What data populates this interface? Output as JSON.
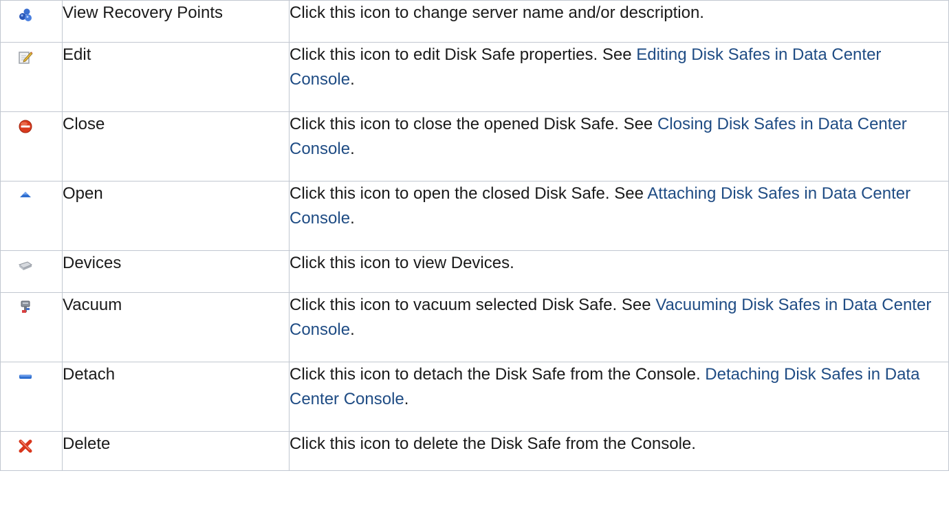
{
  "rows": [
    {
      "icon": "view-recovery-points-icon",
      "name": "View Recovery Points",
      "description": "Click this icon to change server name and/or description.",
      "link_text": "",
      "suffix": ""
    },
    {
      "icon": "edit-icon",
      "name": "Edit",
      "description": "Click this icon to edit Disk Safe properties. See ",
      "link_text": "Editing Disk Safes in Data Center Console",
      "suffix": "."
    },
    {
      "icon": "stop-icon",
      "name": "Close",
      "description": "Click this icon to close the opened Disk Safe. See ",
      "link_text": "Closing Disk Safes in Data Center Console",
      "suffix": "."
    },
    {
      "icon": "open-triangle-icon",
      "name": "Open",
      "description": "Click this icon to open the closed Disk Safe. See ",
      "link_text": "Attaching Disk Safes in Data Center Console",
      "suffix": "."
    },
    {
      "icon": "devices-icon",
      "name": "Devices",
      "description": "Click this icon to view Devices.",
      "link_text": "",
      "suffix": ""
    },
    {
      "icon": "vacuum-icon",
      "name": "Vacuum",
      "description": "Click this icon to vacuum selected Disk Safe. See ",
      "link_text": "Vacuuming Disk Safes in Data Center Console",
      "suffix": "."
    },
    {
      "icon": "detach-icon",
      "name": "Detach",
      "description": "Click this icon to detach the Disk Safe from the Console. ",
      "link_text": "Detaching Disk Safes in Data Center Console",
      "suffix": "."
    },
    {
      "icon": "delete-icon",
      "name": "Delete",
      "description": "Click this icon to delete the Disk Safe from the Console.",
      "link_text": "",
      "suffix": ""
    }
  ],
  "colors": {
    "border": "#c1c7d0",
    "link": "#1f4c84",
    "text": "#1a1a1a"
  }
}
